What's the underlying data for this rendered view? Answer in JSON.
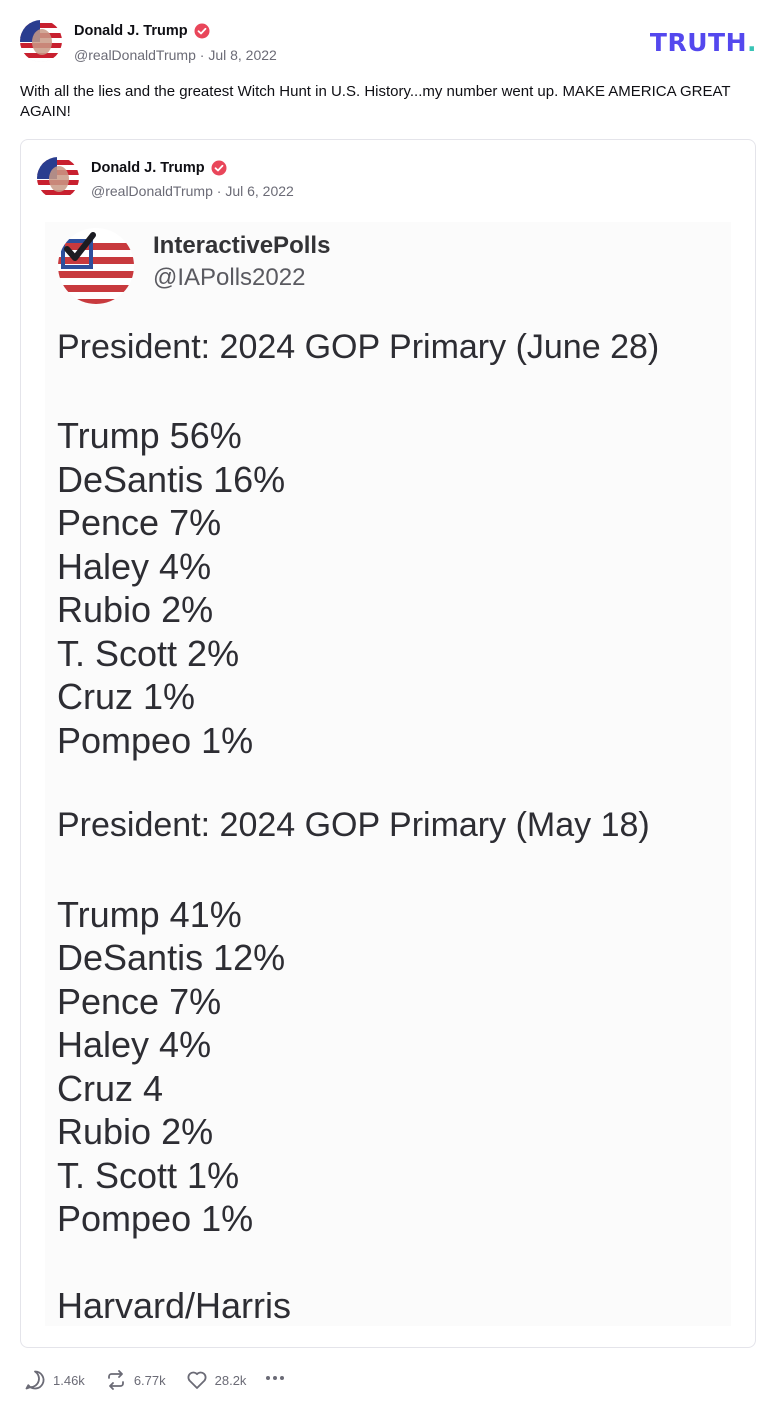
{
  "post": {
    "author_name": "Donald J. Trump",
    "handle": "@realDonaldTrump",
    "separator": "·",
    "date": "Jul 8, 2022",
    "text": "With all the lies and the greatest Witch Hunt in U.S. History...my number went up. MAKE AMERICA GREAT AGAIN!",
    "logo_text": "TRUTH",
    "logo_dot": "."
  },
  "quote": {
    "author_name": "Donald J. Trump",
    "handle": "@realDonaldTrump",
    "separator": "·",
    "date": "Jul 6, 2022",
    "image": {
      "brand": "InteractivePolls",
      "handle": "@IAPolls2022",
      "poll1": {
        "heading": "President: 2024 GOP Primary (June 28)",
        "lines": [
          "Trump 56%",
          "DeSantis 16%",
          "Pence 7%",
          "Haley 4%",
          "Rubio 2%",
          "T. Scott 2%",
          "Cruz 1%",
          "Pompeo 1%"
        ]
      },
      "poll2": {
        "heading": "President: 2024 GOP Primary (May 18)",
        "lines": [
          "Trump 41%",
          "DeSantis 12%",
          "Pence 7%",
          "Haley 4%",
          "Cruz 4",
          "Rubio 2%",
          "T. Scott 1%",
          "Pompeo 1%"
        ]
      },
      "source": "Harvard/Harris"
    }
  },
  "actions": {
    "replies": "1.46k",
    "retruths": "6.77k",
    "likes": "28.2k",
    "more_icon": "ellipsis-icon"
  },
  "colors": {
    "brand": "#5448ee",
    "brand_dot": "#38c4b5",
    "verified": "#e9465a",
    "muted_text": "#6b6b76"
  }
}
